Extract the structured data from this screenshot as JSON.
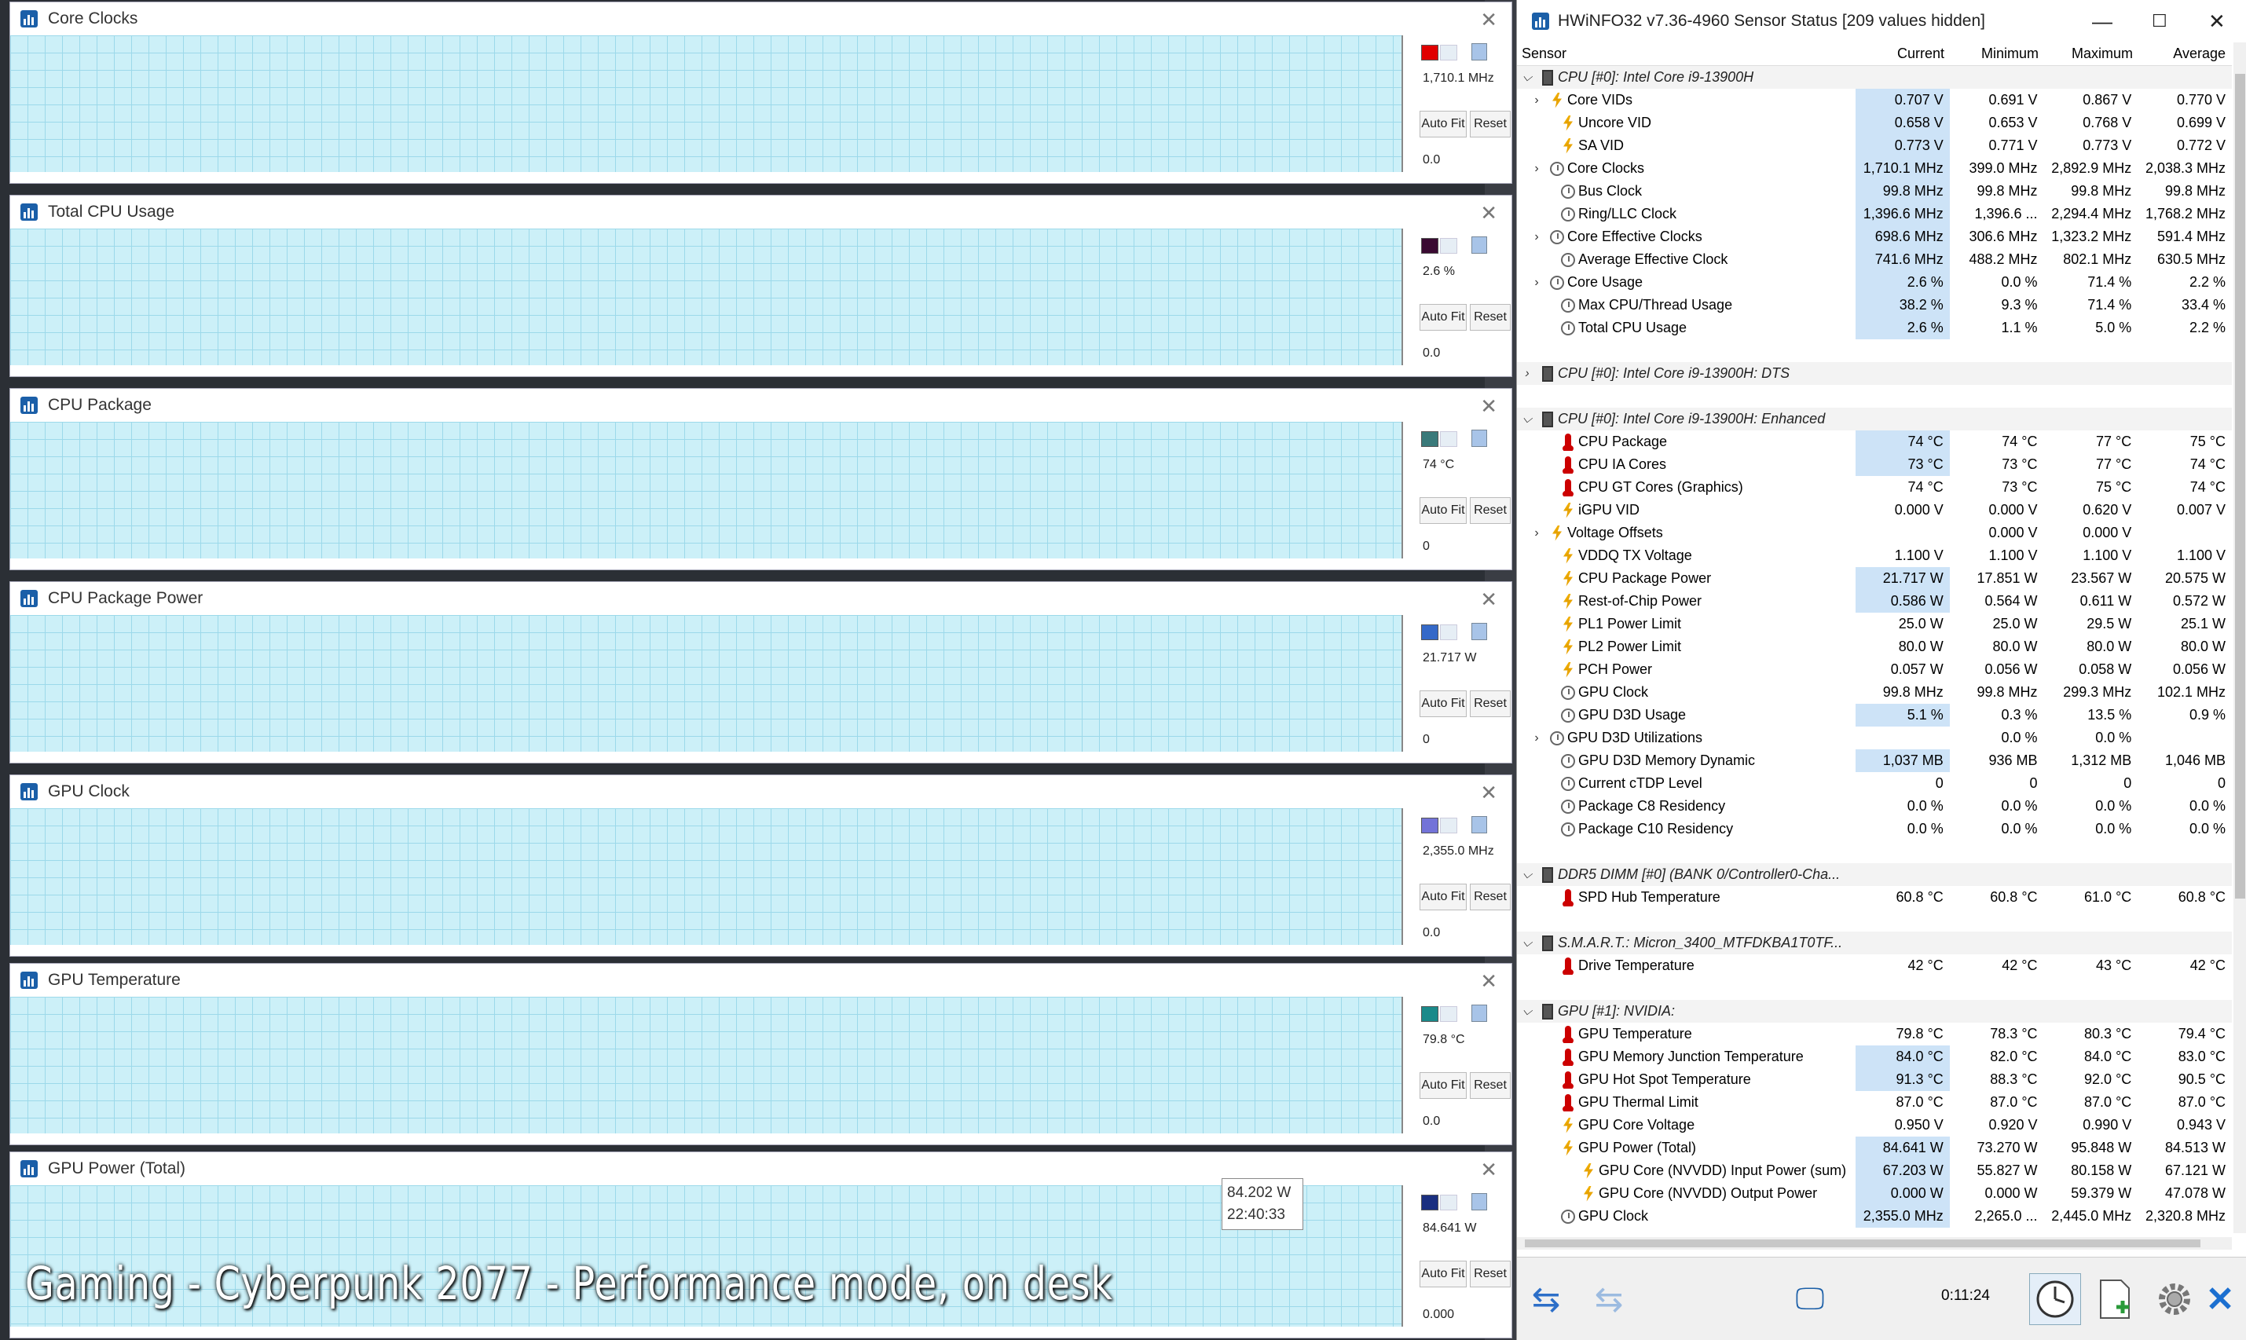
{
  "graphs": [
    {
      "title": "Core Clocks",
      "max": "100",
      "current": "1,710.1 MHz",
      "min": "0.0",
      "color": "#f58f8f",
      "line": "#d92e2e",
      "swatch": "#e00000",
      "autofit": "Auto Fit",
      "reset": "Reset",
      "level": 0.2
    },
    {
      "title": "Total CPU Usage",
      "max": "100.0",
      "current": "2.6 %",
      "min": "0.0",
      "color": "#9a8a9a",
      "line": "#4a1040",
      "swatch": "#3a0a32",
      "autofit": "Auto Fit",
      "reset": "Reset",
      "level": 0.04
    },
    {
      "title": "CPU Package",
      "max": "100",
      "current": "74 °C",
      "min": "0",
      "color": "#8ea8a4",
      "line": "#2f6e6e",
      "swatch": "#3a7a7a",
      "autofit": "Auto Fit",
      "reset": "Reset",
      "level": 0.74
    },
    {
      "title": "CPU Package Power",
      "max": "150",
      "current": "21.717 W",
      "min": "0",
      "color": "#7fa6e0",
      "line": "#3569c8",
      "swatch": "#3569c8",
      "autofit": "Auto Fit",
      "reset": "Reset",
      "level": 0.1
    },
    {
      "title": "GPU Clock",
      "max": "0",
      "current": "2,355.0 MHz",
      "min": "0.0",
      "color": "#adadf2",
      "line": "#5d5dd0",
      "swatch": "#7373d8",
      "autofit": "Auto Fit",
      "reset": "Reset",
      "level": 0.72
    },
    {
      "title": "GPU Temperature",
      "max": "100",
      "current": "79.8 °C",
      "min": "0.0",
      "color": "#8fb1b0",
      "line": "#2a8080",
      "swatch": "#1a8a8a",
      "autofit": "Auto Fit",
      "reset": "Reset",
      "level": 0.78
    },
    {
      "title": "GPU Power (Total)",
      "max": "100",
      "current": "84.641 W",
      "min": "0.000",
      "color": "#93a4bd",
      "line": "#1f3f8f",
      "swatch": "#1a2f80",
      "autofit": "Auto Fit",
      "reset": "Reset",
      "level": 0.75
    }
  ],
  "tooltip": {
    "value": "84.202 W",
    "time": "22:40:33"
  },
  "caption": "Gaming - Cyberpunk 2077 - Performance mode, on desk",
  "hwinfo": {
    "title": "HWiNFO32 v7.36-4960 Sensor Status [209 values hidden]",
    "columns": [
      "Sensor",
      "Current",
      "Minimum",
      "Maximum",
      "Average"
    ],
    "rows": [
      {
        "type": "grp",
        "exp": "v",
        "name": "CPU [#0]: Intel Core i9-13900H"
      },
      {
        "exp": ">",
        "icon": "bolt",
        "ind": 1,
        "name": "Core VIDs",
        "v": [
          "0.707 V",
          "0.691 V",
          "0.867 V",
          "0.770 V"
        ],
        "hl": true
      },
      {
        "icon": "bolt",
        "name": "Uncore VID",
        "v": [
          "0.658 V",
          "0.653 V",
          "0.768 V",
          "0.699 V"
        ],
        "hl": true
      },
      {
        "icon": "bolt",
        "name": "SA VID",
        "v": [
          "0.773 V",
          "0.771 V",
          "0.773 V",
          "0.772 V"
        ],
        "hl": true
      },
      {
        "exp": ">",
        "icon": "clock",
        "ind": 1,
        "name": "Core Clocks",
        "v": [
          "1,710.1 MHz",
          "399.0 MHz",
          "2,892.9 MHz",
          "2,038.3 MHz"
        ],
        "hl": true
      },
      {
        "icon": "clock",
        "name": "Bus Clock",
        "v": [
          "99.8 MHz",
          "99.8 MHz",
          "99.8 MHz",
          "99.8 MHz"
        ],
        "hl": true
      },
      {
        "icon": "clock",
        "name": "Ring/LLC Clock",
        "v": [
          "1,396.6 MHz",
          "1,396.6 ...",
          "2,294.4 MHz",
          "1,768.2 MHz"
        ],
        "hl": true
      },
      {
        "exp": ">",
        "icon": "clock",
        "ind": 1,
        "name": "Core Effective Clocks",
        "v": [
          "698.6 MHz",
          "306.6 MHz",
          "1,323.2 MHz",
          "591.4 MHz"
        ],
        "hl": true
      },
      {
        "icon": "clock",
        "name": "Average Effective Clock",
        "v": [
          "741.6 MHz",
          "488.2 MHz",
          "802.1 MHz",
          "630.5 MHz"
        ],
        "hl": true
      },
      {
        "exp": ">",
        "icon": "clock",
        "ind": 1,
        "name": "Core Usage",
        "v": [
          "2.6 %",
          "0.0 %",
          "71.4 %",
          "2.2 %"
        ],
        "hl": true
      },
      {
        "icon": "clock",
        "name": "Max CPU/Thread Usage",
        "v": [
          "38.2 %",
          "9.3 %",
          "71.4 %",
          "33.4 %"
        ],
        "hl": true
      },
      {
        "icon": "clock",
        "name": "Total CPU Usage",
        "v": [
          "2.6 %",
          "1.1 %",
          "5.0 %",
          "2.2 %"
        ],
        "hl": true
      },
      {
        "type": "blank"
      },
      {
        "type": "grp",
        "exp": ">",
        "name": "CPU [#0]: Intel Core i9-13900H: DTS"
      },
      {
        "type": "blank"
      },
      {
        "type": "grp",
        "exp": "v",
        "name": "CPU [#0]: Intel Core i9-13900H: Enhanced"
      },
      {
        "icon": "therm",
        "name": "CPU Package",
        "v": [
          "74 °C",
          "74 °C",
          "77 °C",
          "75 °C"
        ],
        "hl": true
      },
      {
        "icon": "therm",
        "name": "CPU IA Cores",
        "v": [
          "73 °C",
          "73 °C",
          "77 °C",
          "74 °C"
        ],
        "hl": true
      },
      {
        "icon": "therm",
        "name": "CPU GT Cores (Graphics)",
        "v": [
          "74 °C",
          "73 °C",
          "75 °C",
          "74 °C"
        ]
      },
      {
        "icon": "bolt",
        "name": "iGPU VID",
        "v": [
          "0.000 V",
          "0.000 V",
          "0.620 V",
          "0.007 V"
        ]
      },
      {
        "exp": ">",
        "icon": "bolt",
        "ind": 1,
        "name": "Voltage Offsets",
        "v": [
          "",
          "0.000 V",
          "0.000 V",
          ""
        ]
      },
      {
        "icon": "bolt",
        "name": "VDDQ TX Voltage",
        "v": [
          "1.100 V",
          "1.100 V",
          "1.100 V",
          "1.100 V"
        ]
      },
      {
        "icon": "bolt",
        "name": "CPU Package Power",
        "v": [
          "21.717 W",
          "17.851 W",
          "23.567 W",
          "20.575 W"
        ],
        "hl": true
      },
      {
        "icon": "bolt",
        "name": "Rest-of-Chip Power",
        "v": [
          "0.586 W",
          "0.564 W",
          "0.611 W",
          "0.572 W"
        ],
        "hl": true
      },
      {
        "icon": "bolt",
        "name": "PL1 Power Limit",
        "v": [
          "25.0 W",
          "25.0 W",
          "29.5 W",
          "25.1 W"
        ]
      },
      {
        "icon": "bolt",
        "name": "PL2 Power Limit",
        "v": [
          "80.0 W",
          "80.0 W",
          "80.0 W",
          "80.0 W"
        ]
      },
      {
        "icon": "bolt",
        "name": "PCH Power",
        "v": [
          "0.057 W",
          "0.056 W",
          "0.058 W",
          "0.056 W"
        ]
      },
      {
        "icon": "clock",
        "name": "GPU Clock",
        "v": [
          "99.8 MHz",
          "99.8 MHz",
          "299.3 MHz",
          "102.1 MHz"
        ]
      },
      {
        "icon": "clock",
        "name": "GPU D3D Usage",
        "v": [
          "5.1 %",
          "0.3 %",
          "13.5 %",
          "0.9 %"
        ],
        "hl": true
      },
      {
        "exp": ">",
        "icon": "clock",
        "ind": 1,
        "name": "GPU D3D Utilizations",
        "v": [
          "",
          "0.0 %",
          "0.0 %",
          ""
        ]
      },
      {
        "icon": "clock",
        "name": "GPU D3D Memory Dynamic",
        "v": [
          "1,037 MB",
          "936 MB",
          "1,312 MB",
          "1,046 MB"
        ],
        "hl": true
      },
      {
        "icon": "clock",
        "name": "Current cTDP Level",
        "v": [
          "0",
          "0",
          "0",
          "0"
        ]
      },
      {
        "icon": "clock",
        "name": "Package C8 Residency",
        "v": [
          "0.0 %",
          "0.0 %",
          "0.0 %",
          "0.0 %"
        ]
      },
      {
        "icon": "clock",
        "name": "Package C10 Residency",
        "v": [
          "0.0 %",
          "0.0 %",
          "0.0 %",
          "0.0 %"
        ]
      },
      {
        "type": "blank"
      },
      {
        "type": "grp",
        "exp": "v",
        "name": "DDR5 DIMM [#0] (BANK 0/Controller0-Cha..."
      },
      {
        "icon": "therm",
        "name": "SPD Hub Temperature",
        "v": [
          "60.8 °C",
          "60.8 °C",
          "61.0 °C",
          "60.8 °C"
        ]
      },
      {
        "type": "blank"
      },
      {
        "type": "grp",
        "exp": "v",
        "name": "S.M.A.R.T.: Micron_3400_MTFDKBA1T0TF..."
      },
      {
        "icon": "therm",
        "name": "Drive Temperature",
        "v": [
          "42 °C",
          "42 °C",
          "43 °C",
          "42 °C"
        ]
      },
      {
        "type": "blank"
      },
      {
        "type": "grp",
        "exp": "v",
        "name": "GPU [#1]: NVIDIA:"
      },
      {
        "icon": "therm",
        "name": "GPU Temperature",
        "v": [
          "79.8 °C",
          "78.3 °C",
          "80.3 °C",
          "79.4 °C"
        ]
      },
      {
        "icon": "therm",
        "name": "GPU Memory Junction Temperature",
        "v": [
          "84.0 °C",
          "82.0 °C",
          "84.0 °C",
          "83.0 °C"
        ],
        "hl": true
      },
      {
        "icon": "therm",
        "name": "GPU Hot Spot Temperature",
        "v": [
          "91.3 °C",
          "88.3 °C",
          "92.0 °C",
          "90.5 °C"
        ],
        "hl": true
      },
      {
        "icon": "therm",
        "name": "GPU Thermal Limit",
        "v": [
          "87.0 °C",
          "87.0 °C",
          "87.0 °C",
          "87.0 °C"
        ]
      },
      {
        "icon": "bolt",
        "name": "GPU Core Voltage",
        "v": [
          "0.950 V",
          "0.920 V",
          "0.990 V",
          "0.943 V"
        ]
      },
      {
        "icon": "bolt",
        "name": "GPU Power (Total)",
        "v": [
          "84.641 W",
          "73.270 W",
          "95.848 W",
          "84.513 W"
        ],
        "hl": true
      },
      {
        "icon": "bolt",
        "ind": 2,
        "name": "GPU Core (NVVDD) Input Power (sum)",
        "v": [
          "67.203 W",
          "55.827 W",
          "80.158 W",
          "67.121 W"
        ],
        "hl": true
      },
      {
        "icon": "bolt",
        "ind": 2,
        "name": "GPU Core (NVVDD) Output Power",
        "v": [
          "0.000 W",
          "0.000 W",
          "59.379 W",
          "47.078 W"
        ],
        "hl": true
      },
      {
        "icon": "clock",
        "name": "GPU Clock",
        "v": [
          "2,355.0 MHz",
          "2,265.0 ...",
          "2,445.0 MHz",
          "2,320.8 MHz"
        ],
        "hl": true
      }
    ],
    "timer": "0:11:24"
  }
}
